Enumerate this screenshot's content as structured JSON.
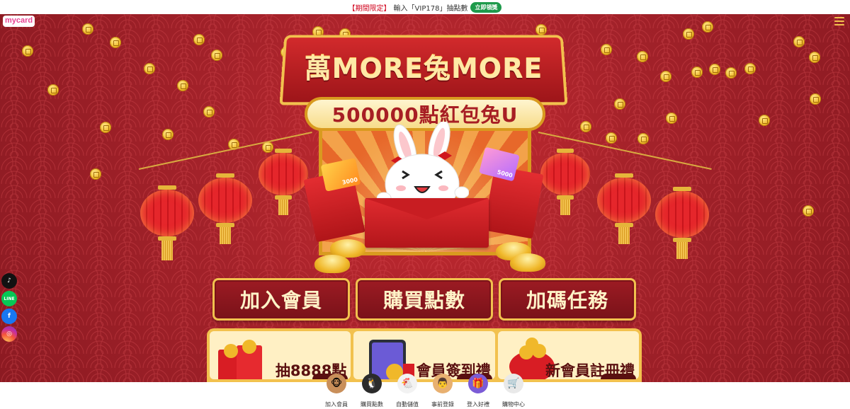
{
  "promo": {
    "tag": "【期間限定】",
    "text": "輸入「VIP178」抽點數",
    "button": "立即領獎"
  },
  "header": {
    "logo": "mycard"
  },
  "hero": {
    "title": "萬MORE兔MORE",
    "subtitle": "500000點紅包兔U",
    "card_left_value": "3000",
    "card_right_value": "5000"
  },
  "actions": [
    {
      "label": "加入會員"
    },
    {
      "label": "購買點數"
    },
    {
      "label": "加碼任務"
    }
  ],
  "promo_cards": [
    {
      "label": "抽8888點"
    },
    {
      "label": "會員簽到禮"
    },
    {
      "label": "新會員註冊禮"
    }
  ],
  "social": [
    "tiktok-icon",
    "line-icon",
    "facebook-icon",
    "instagram-icon"
  ],
  "social_labels": {
    "line": "LINE",
    "fb": "f",
    "tiktok": "♪",
    "ig": "◎"
  },
  "bottom_nav": [
    {
      "label": "加入會員",
      "icon": "monkey-icon"
    },
    {
      "label": "購買點數",
      "icon": "penguin-icon"
    },
    {
      "label": "自動儲值",
      "icon": "rooster-icon"
    },
    {
      "label": "事前登錄",
      "icon": "mustache-icon"
    },
    {
      "label": "登入好禮",
      "icon": "gift-box-icon"
    },
    {
      "label": "購物中心",
      "icon": "shopping-cart-icon"
    }
  ],
  "colors": {
    "background": "#8f1a22",
    "gold": "#f2c14e",
    "promo_green": "#1e9a4b",
    "promo_red": "#d0021b"
  }
}
